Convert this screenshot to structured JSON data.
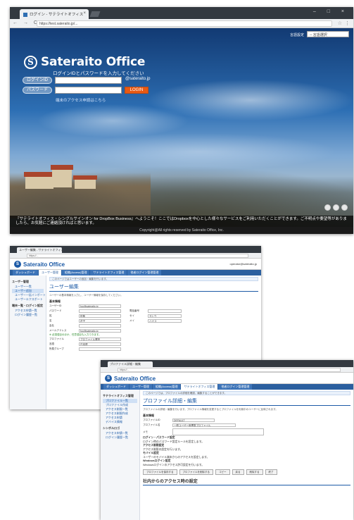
{
  "window1": {
    "tab_title": "ログイン - サテライトオフィス",
    "url": "https://test.sateraito.jp/...",
    "window_controls": "–  □  ×",
    "lang_label": "言語設定",
    "lang_value": "-- 言語選択",
    "logo_mark": "S",
    "logo_text": "Sateraito Office",
    "login_hint": "ログインIDとパスワードを入力してください",
    "id_label": "ログインID",
    "password_label": "パスワード",
    "domain_suffix": "@sateraito.jp",
    "login_button": "LOGIN",
    "access_link": "端末のアクセス申請はこちら",
    "caption": "『サテライトオフィス・シングルサインオン for DropBox Business』へようこそ！ここではDropboxを中心とした様々なサービスをご利用いただくことができます。ご不明点や要望等がありましたら、お気軽にご連絡頂ければと思います。",
    "copyright": "Copyright@All rights reserved by Sateraito Office, Inc."
  },
  "window2": {
    "tab_title": "ユーザー編集 - サテライトオフィス",
    "url": "https://...",
    "logo_text": "Sateraito Office",
    "user": "operator@sateraito.jp",
    "tabs": [
      "ダッシュボード",
      "ユーザー管理",
      "組織(Access)管理",
      "サテライトオフィス管理",
      "他者ログイン管理管理"
    ],
    "active_tab": 1,
    "side_groups": [
      {
        "title": "ユーザー管理",
        "items": [
          "ユーザー一覧",
          "ユーザー追加",
          "ユーザー一括インポート",
          "ユーザーエクスポート"
        ]
      },
      {
        "title": "端末一覧・ログイン設定",
        "items": [
          "アクセス申請一覧",
          "ログイン履歴一覧"
        ]
      }
    ],
    "banner": "このページではユーザーの追加・編集を行います。",
    "page_title": "ユーザー編集",
    "desc": "ユーザーの基本情報を入力し、ユーザー情報を保存してください。",
    "section": "基本情報",
    "fields": [
      {
        "label": "ユーザーID",
        "value": "foo@sateraito.jp"
      },
      {
        "label": "パスワード",
        "value": ""
      },
      {
        "label": "姓",
        "value": "佐藤"
      },
      {
        "label": "名",
        "value": "花子"
      },
      {
        "label": "会社",
        "value": ""
      },
      {
        "label": "メールアドレス",
        "value": "foo@sateraito.jp"
      },
      {
        "label": "プロファイル",
        "value": "プロファイル選択"
      },
      {
        "label": "言語",
        "value": "日本語"
      },
      {
        "label": "所属グループ",
        "value": ""
      }
    ],
    "right_fields": [
      {
        "label": "電話番号",
        "value": ""
      },
      {
        "label": "セイ",
        "value": "サトウ"
      },
      {
        "label": "メイ",
        "value": "ハナコ"
      }
    ],
    "green_note": "※ 必須項目のほか、任意項目も入力できます。"
  },
  "window3": {
    "tab_title": "プロファイル詳細・編集",
    "url": "https://...",
    "logo_text": "Sateraito Office",
    "tabs": [
      "ダッシュボード",
      "ユーザー管理",
      "組織(Access)管理",
      "サテライトオフィス管理",
      "他者ログイン管理管理"
    ],
    "active_tab": 3,
    "side_groups": [
      {
        "title": "サテライトオフィス管理",
        "items": [
          "プロファイル一覧",
          "プロファイル作成",
          "アクセス制限一覧",
          "アクセス制限作成",
          "アクセス申請",
          "デバイス情報"
        ]
      },
      {
        "title": "シンボルロゴ",
        "items": [
          "アクセス申請一覧",
          "ログイン履歴一覧"
        ]
      }
    ],
    "banner": "このページでは、プロファイルの詳細を確認、編集することができます。",
    "page_title": "プロファイル詳細・編集",
    "desc": "プロファイルの詳細・編集を行います。プロファイル情報を変更するとプロファイルを利用中のユーザーに反映されます。",
    "section": "基本情報",
    "fields": [
      {
        "label": "プロファイルID",
        "value": "DEFAULT"
      },
      {
        "label": "プロファイル名",
        "value": "一般ユーザー用標準プロファイル"
      },
      {
        "label": "メモ",
        "value": ""
      }
    ],
    "checks": [
      {
        "title": "ログイン・パスワード設定",
        "text": "ログイン時のパスワード設定ルールを設定します。"
      },
      {
        "title": "アクセス制限設定",
        "text": "アクセス制限の設定を行います。"
      },
      {
        "title": "モバイル設定",
        "text": "ユーザーのモバイル端末からのアクセスを設定します。"
      },
      {
        "title": "Windowsログイン設定",
        "text": "Windowsログインのアクセス許可設定を行います。"
      }
    ],
    "buttons": [
      "プロファイルを保存する",
      "プロファイルを削除する",
      "コピー",
      "戻る",
      "削除する",
      "終了"
    ],
    "h2": "社内からのアクセス時の設定"
  }
}
